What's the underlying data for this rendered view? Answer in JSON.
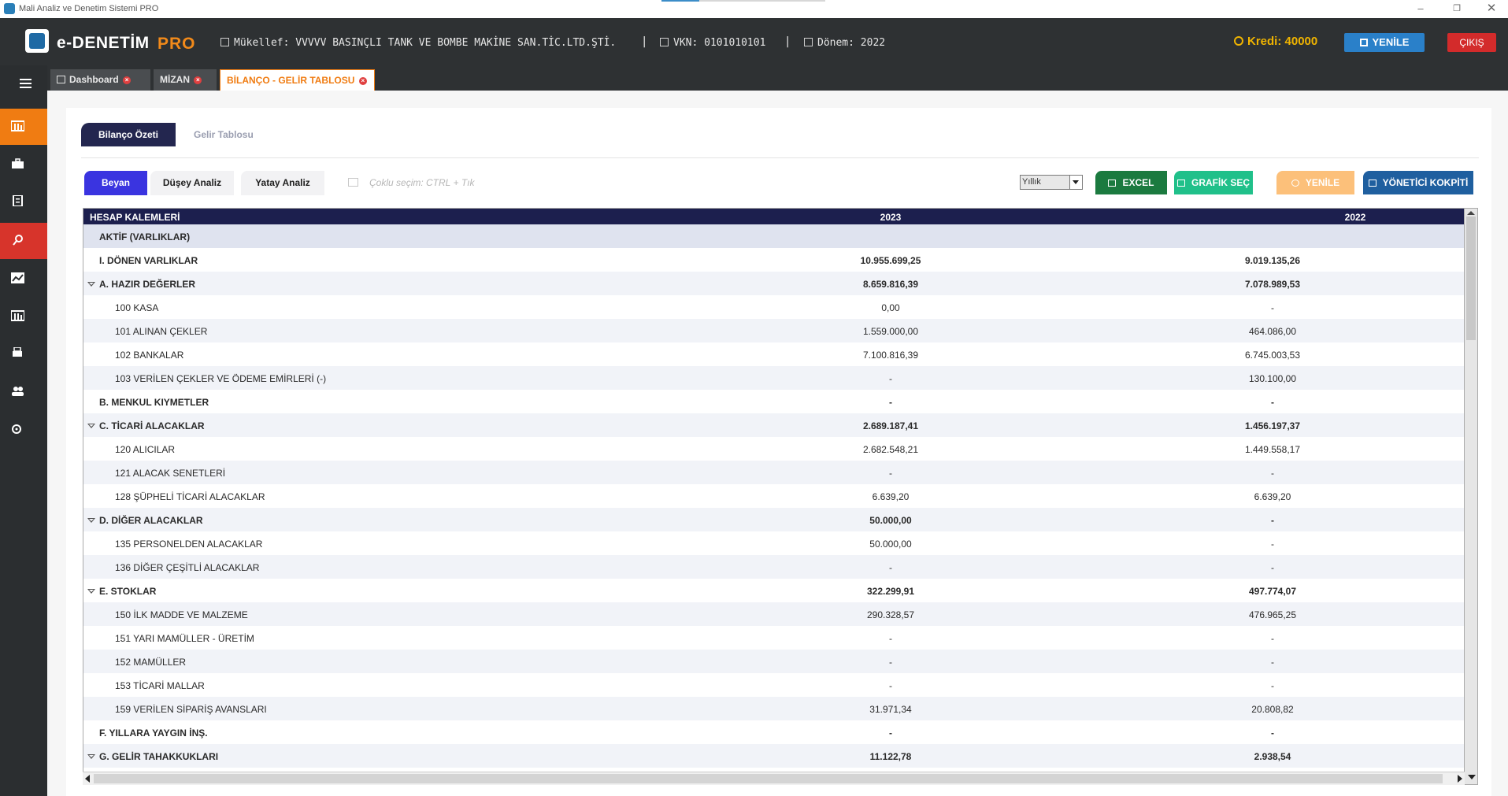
{
  "window": {
    "title": "Mali Analiz ve Denetim Sistemi PRO",
    "min_icon": "minimize-icon",
    "max_icon": "restore-icon",
    "close_icon": "close-icon"
  },
  "header": {
    "brand": "e-DENETİM",
    "brand_suffix": "PRO",
    "mukellef": "Mükellef: VVVVV BASINÇLI TANK VE BOMBE MAKİNE SAN.TİC.LTD.ŞTİ.",
    "sep1": "|",
    "vkn": "VKN: 0101010101",
    "sep2": "|",
    "donem": "Dönem: 2022",
    "kredi": "Kredi: 40000",
    "yenile_label": "YENİLE",
    "cikis_label": "ÇIKIŞ",
    "colors": {
      "bg": "#2e3133",
      "accent": "#f28a1a",
      "kredi": "#f0b400",
      "yenile": "#2a80c9",
      "cikis": "#d32b2b"
    }
  },
  "sidebar": {
    "icons": [
      "menu-icon",
      "dashboard-icon",
      "briefcase-icon",
      "document-icon",
      "search-icon",
      "chart-icon",
      "report-icon",
      "printer-icon",
      "users-icon",
      "settings-icon"
    ],
    "active_color": "#f07c12",
    "highlight_color": "#d7342b"
  },
  "tabs": [
    {
      "label": "Dashboard",
      "close": "×"
    },
    {
      "label": "MİZAN",
      "close": "×"
    },
    {
      "label": "BİLANÇO - GELİR TABLOSU",
      "close": "×",
      "active": true
    }
  ],
  "subtabs": {
    "active": "Bilanço Özeti",
    "other": "Gelir Tablosu"
  },
  "toolbar": {
    "modes": [
      "Beyan",
      "Düşey Analiz",
      "Yatay Analiz"
    ],
    "multi_select_hint": "Çoklu seçim: CTRL + Tık",
    "period_value": "Yıllık",
    "excel_label": "EXCEL",
    "grafik_label": "GRAFİK SEÇ",
    "yenile_label": "YENİLE",
    "kokpit_label": "YÖNETİCİ KOKPİTİ",
    "colors": {
      "beyan": "#3a34e0",
      "excel": "#1b7a3f",
      "grafik": "#20c08a",
      "yenile": "#fcc07a",
      "kokpit": "#1f5f9f"
    }
  },
  "table": {
    "columns": [
      "HESAP KALEMLERİ",
      "2023",
      "2022"
    ],
    "rows": [
      {
        "label": "AKTİF (VARLIKLAR)",
        "v1": "",
        "v2": ""
      },
      {
        "label": "I. DÖNEN VARLIKLAR",
        "v1": "10.955.699,25",
        "v2": "9.019.135,26"
      },
      {
        "label": "A. HAZIR DEĞERLER",
        "v1": "8.659.816,39",
        "v2": "7.078.989,53"
      },
      {
        "label": "100 KASA",
        "v1": "0,00",
        "v2": "-"
      },
      {
        "label": "101 ALINAN ÇEKLER",
        "v1": "1.559.000,00",
        "v2": "464.086,00"
      },
      {
        "label": "102 BANKALAR",
        "v1": "7.100.816,39",
        "v2": "6.745.003,53"
      },
      {
        "label": "103 VERİLEN ÇEKLER VE ÖDEME EMİRLERİ (-)",
        "v1": "-",
        "v2": "130.100,00"
      },
      {
        "label": "B. MENKUL KIYMETLER",
        "v1": "-",
        "v2": "-"
      },
      {
        "label": "C. TİCARİ ALACAKLAR",
        "v1": "2.689.187,41",
        "v2": "1.456.197,37"
      },
      {
        "label": "120 ALICILAR",
        "v1": "2.682.548,21",
        "v2": "1.449.558,17"
      },
      {
        "label": "121 ALACAK SENETLERİ",
        "v1": "-",
        "v2": "-"
      },
      {
        "label": "128 ŞÜPHELİ TİCARİ ALACAKLAR",
        "v1": "6.639,20",
        "v2": "6.639,20"
      },
      {
        "label": "D. DİĞER ALACAKLAR",
        "v1": "50.000,00",
        "v2": "-"
      },
      {
        "label": "135 PERSONELDEN ALACAKLAR",
        "v1": "50.000,00",
        "v2": "-"
      },
      {
        "label": "136 DİĞER ÇEŞİTLİ ALACAKLAR",
        "v1": "-",
        "v2": "-"
      },
      {
        "label": "E. STOKLAR",
        "v1": "322.299,91",
        "v2": "497.774,07"
      },
      {
        "label": "150 İLK MADDE VE MALZEME",
        "v1": "290.328,57",
        "v2": "476.965,25"
      },
      {
        "label": "151 YARI MAMÜLLER - ÜRETİM",
        "v1": "-",
        "v2": "-"
      },
      {
        "label": "152 MAMÜLLER",
        "v1": "-",
        "v2": "-"
      },
      {
        "label": "153 TİCARİ MALLAR",
        "v1": "-",
        "v2": "-"
      },
      {
        "label": "159 VERİLEN SİPARİŞ AVANSLARI",
        "v1": "31.971,34",
        "v2": "20.808,82"
      },
      {
        "label": "F. YILLARA YAYGIN İNŞ.",
        "v1": "-",
        "v2": "-"
      },
      {
        "label": "G. GELİR TAHAKKUKLARI",
        "v1": "11.122,78",
        "v2": "2.938,54"
      }
    ]
  }
}
